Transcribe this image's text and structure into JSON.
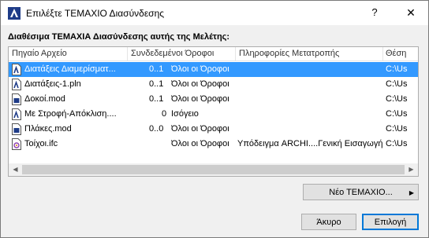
{
  "window": {
    "title": "Επιλέξτε ΤΕΜΑΧΙΟ Διασύνδεσης",
    "help_label": "?",
    "close_label": "✕"
  },
  "section_label": "Διαθέσιμα ΤΕΜΑΧΙΑ Διασύνδεσης αυτής της Μελέτης:",
  "columns": [
    "Πηγαίο Αρχείο",
    "Συνδεδεμένοι Όροφοι",
    "Πληροφορίες Μετατροπής",
    "Θέση"
  ],
  "rows": [
    {
      "file": "Διατάξεις Διαμερίσματ...",
      "count": "0..1",
      "floors": "Όλοι οι Όροφοι",
      "conversion": "",
      "location": "C:\\Us",
      "icon": "pln-file-icon",
      "selected": true
    },
    {
      "file": "Διατάξεις-1.pln",
      "count": "0..1",
      "floors": "Όλοι οι Όροφοι",
      "conversion": "",
      "location": "C:\\Us",
      "icon": "pln-file-icon",
      "selected": false
    },
    {
      "file": "Δοκοί.mod",
      "count": "0..1",
      "floors": "Όλοι οι Όροφοι",
      "conversion": "",
      "location": "C:\\Us",
      "icon": "mod-file-icon",
      "selected": false
    },
    {
      "file": "Με Στροφή-Απόκλιση....",
      "count": "0",
      "floors": "Ισόγειο",
      "conversion": "",
      "location": "C:\\Us",
      "icon": "pln-file-icon",
      "selected": false
    },
    {
      "file": "Πλάκες.mod",
      "count": "0..0",
      "floors": "Όλοι οι Όροφοι",
      "conversion": "",
      "location": "C:\\Us",
      "icon": "mod-file-icon",
      "selected": false
    },
    {
      "file": "Τοίχοι.ifc",
      "count": "",
      "floors": "Όλοι οι Όροφοι",
      "conversion": "Υπόδειγμα ARCHI....Γενική Εισαγωγή",
      "location": "C:\\Us",
      "icon": "ifc-file-icon",
      "selected": false
    }
  ],
  "buttons": {
    "new_module": "Νέο ΤΕΜΑΧΙΟ...",
    "cancel": "Άκυρο",
    "ok": "Επιλογή"
  },
  "colors": {
    "selection": "#3399ff",
    "default_button_border": "#0078d7"
  }
}
